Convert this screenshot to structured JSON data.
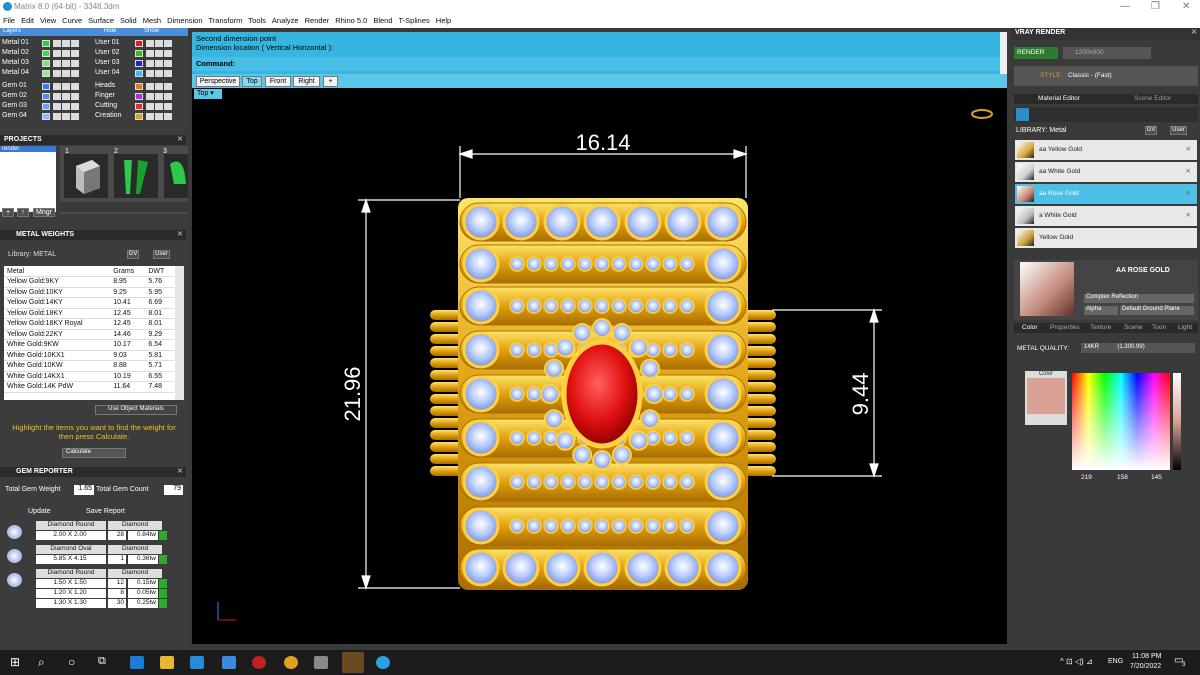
{
  "window": {
    "title": "Matrix 8.0 (64-bit) - 3348.3dm",
    "min": "—",
    "max": "❐",
    "close": "✕"
  },
  "menu": [
    "File",
    "Edit",
    "View",
    "Curve",
    "Surface",
    "Solid",
    "Mesh",
    "Dimension",
    "Transform",
    "Tools",
    "Analyze",
    "Render",
    "Rhino 5.0",
    "Blend",
    "T-Splines",
    "Help"
  ],
  "layers": {
    "header": "Layers",
    "hide": "Hide",
    "show": "Show",
    "left": [
      {
        "name": "Metal 01",
        "color": "#2ec84a"
      },
      {
        "name": "Metal 02",
        "color": "#3fd94f"
      },
      {
        "name": "Metal 03",
        "color": "#7de07a"
      },
      {
        "name": "Metal 04",
        "color": "#9be59a"
      },
      {
        "name": "Gem 01",
        "color": "#3a78ff"
      },
      {
        "name": "Gem 02",
        "color": "#4f8bff"
      },
      {
        "name": "Gem 03",
        "color": "#6fa0ff"
      },
      {
        "name": "Gem 04",
        "color": "#8fb6ff"
      }
    ],
    "right": [
      {
        "name": "User 01",
        "color": "#e02020"
      },
      {
        "name": "User 02",
        "color": "#2ec020"
      },
      {
        "name": "User 03",
        "color": "#2020e0"
      },
      {
        "name": "User 04",
        "color": "#30c0ff"
      },
      {
        "name": "Heads",
        "color": "#e07a10"
      },
      {
        "name": "Finger",
        "color": "#b030e0"
      },
      {
        "name": "Cutting",
        "color": "#e03030"
      },
      {
        "name": "Creation",
        "color": "#e0a020"
      }
    ]
  },
  "projects": {
    "header": "PROJECTS",
    "item": "render",
    "thumbs": [
      "1",
      "2",
      "3"
    ],
    "mngr": "Mngr"
  },
  "metal_weights": {
    "header": "METAL WEIGHTS",
    "library_label": "Library: METAL",
    "gv": "GV",
    "user": "User",
    "columns": [
      "Metal",
      "Grams",
      "DWT"
    ],
    "rows": [
      [
        "Yellow Gold:9KY",
        "8.95",
        "5.76"
      ],
      [
        "Yellow Gold:10KY",
        "9.25",
        "5.95"
      ],
      [
        "Yellow Gold:14KY",
        "10.41",
        "6.69"
      ],
      [
        "Yellow Gold:18KY",
        "12.45",
        "8.01"
      ],
      [
        "Yellow Gold:18KY Royal",
        "12.45",
        "8.01"
      ],
      [
        "Yellow Gold:22KY",
        "14.46",
        "9.29"
      ],
      [
        "White Gold:9KW",
        "10.17",
        "6.54"
      ],
      [
        "White Gold:10KX1",
        "9.03",
        "5.81"
      ],
      [
        "White Gold:10KW",
        "8.88",
        "5.71"
      ],
      [
        "White Gold:14KX1",
        "10.19",
        "6.55"
      ],
      [
        "White Gold:14K PdW",
        "11.64",
        "7.48"
      ]
    ],
    "use_object": "Use Object Materials",
    "hint": "Highlight the items you want to find the weight for then press Calculate.",
    "calculate": "Calculate"
  },
  "gem_reporter": {
    "header": "GEM REPORTER",
    "total_weight_label": "Total Gem Weight",
    "total_weight": "1.65",
    "total_count_label": "Total Gem Count",
    "total_count": "79",
    "update": "Update",
    "save": "Save Report",
    "groups": [
      {
        "shape": "Diamond Round",
        "type": "Diamond",
        "rows": [
          [
            "2.00 X 2.00",
            "28",
            "0.84tw"
          ]
        ]
      },
      {
        "shape": "Diamond Oval",
        "type": "Diamond",
        "rows": [
          [
            "5.85 X 4.15",
            "1",
            "0.36tw"
          ]
        ]
      },
      {
        "shape": "Diamond Round",
        "type": "Diamond",
        "rows": [
          [
            "1.50 X 1.50",
            "12",
            "0.15tw"
          ],
          [
            "1.20 X 1.20",
            "8",
            "0.05tw"
          ],
          [
            "1.30 X 1.30",
            "30",
            "0.25tw"
          ]
        ]
      }
    ]
  },
  "command": {
    "line1": "Second dimension point",
    "line2": "Dimension location ( Vertical  Horizontal ):",
    "prompt": "Command:"
  },
  "viewtabs": [
    "Perspective",
    "Top",
    "Front",
    "Right",
    "+"
  ],
  "viewport_label": "Top",
  "dimensions": {
    "width": "16.14",
    "height": "21.96",
    "inner": "9.44"
  },
  "vray": {
    "header": "VRAY RENDER",
    "render": "RENDER",
    "size": "1200x900",
    "style_label": "STYLE:",
    "style": "Classic - (Fast)",
    "tabs": [
      "Material Editor",
      "Scene Editor"
    ],
    "library": "LIBRARY: Metal",
    "gv": "GV",
    "user": "User",
    "materials": [
      {
        "name": "aa Yellow Gold",
        "color": "#d9a93a"
      },
      {
        "name": "aa White Gold",
        "color": "#d0d0d0"
      },
      {
        "name": "aa Rose Gold",
        "color": "#c98878"
      },
      {
        "name": "a White Gold",
        "color": "#c0c0c0"
      },
      {
        "name": "Yellow Gold",
        "color": "#caa040"
      }
    ],
    "selected_material": "AA ROSE GOLD",
    "complex": "Complex Reflection",
    "alpha": "Alpha",
    "ground": "Default Ground Plane",
    "subtabs": [
      "Color",
      "Properties",
      "Texture",
      "Scene",
      "Toon",
      "Light"
    ],
    "quality_label": "METAL QUALITY:",
    "quality": "14KR",
    "quality_ref": "(1.300.99)",
    "color_label": "Color",
    "swatch": "#d9a196",
    "rgb": {
      "r": "219",
      "g": "158",
      "b": "145"
    }
  },
  "taskbar": {
    "time": "11:08 PM",
    "date": "7/20/2022",
    "lang": "ENG",
    "notif": "3"
  }
}
